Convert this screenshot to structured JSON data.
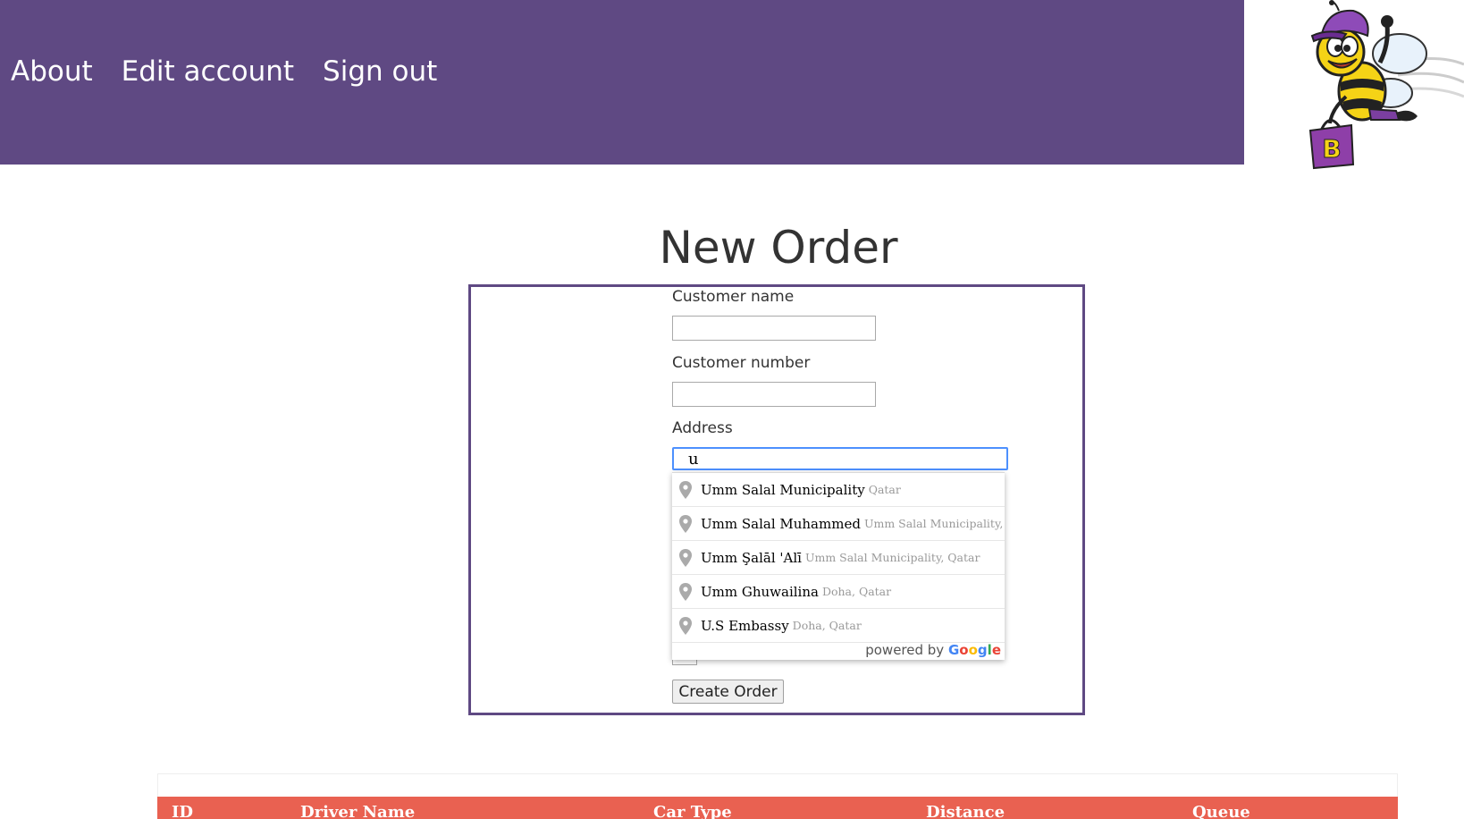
{
  "nav": {
    "items": [
      {
        "label": "About"
      },
      {
        "label": "Edit account"
      },
      {
        "label": "Sign out"
      }
    ]
  },
  "logo": {
    "letter": "B"
  },
  "page": {
    "title": "New Order"
  },
  "form": {
    "customer_name_label": "Customer name",
    "customer_name_value": "",
    "customer_number_label": "Customer number",
    "customer_number_value": "",
    "address_label": "Address",
    "address_value": "u",
    "create_button_label": "Create Order"
  },
  "autocomplete": {
    "items": [
      {
        "main": "Umm Salal Municipality",
        "secondary": "Qatar"
      },
      {
        "main": "Umm Salal Muhammed",
        "secondary": "Umm Salal Municipality, Qatar"
      },
      {
        "main": "Umm Şalāl 'Alī",
        "secondary": "Umm Salal Municipality, Qatar"
      },
      {
        "main": "Umm Ghuwailina",
        "secondary": "Doha, Qatar"
      },
      {
        "main": "U.S Embassy",
        "secondary": "Doha, Qatar"
      }
    ],
    "powered_by": "powered by",
    "google": "Google"
  },
  "table": {
    "headers": [
      "ID",
      "Driver Name",
      "Car Type",
      "Distance",
      "Queue"
    ]
  },
  "colors": {
    "header_bg": "#5f4983",
    "form_border": "#5f4983",
    "table_header_bg": "#e96151",
    "focus_border": "#4d90fe"
  }
}
